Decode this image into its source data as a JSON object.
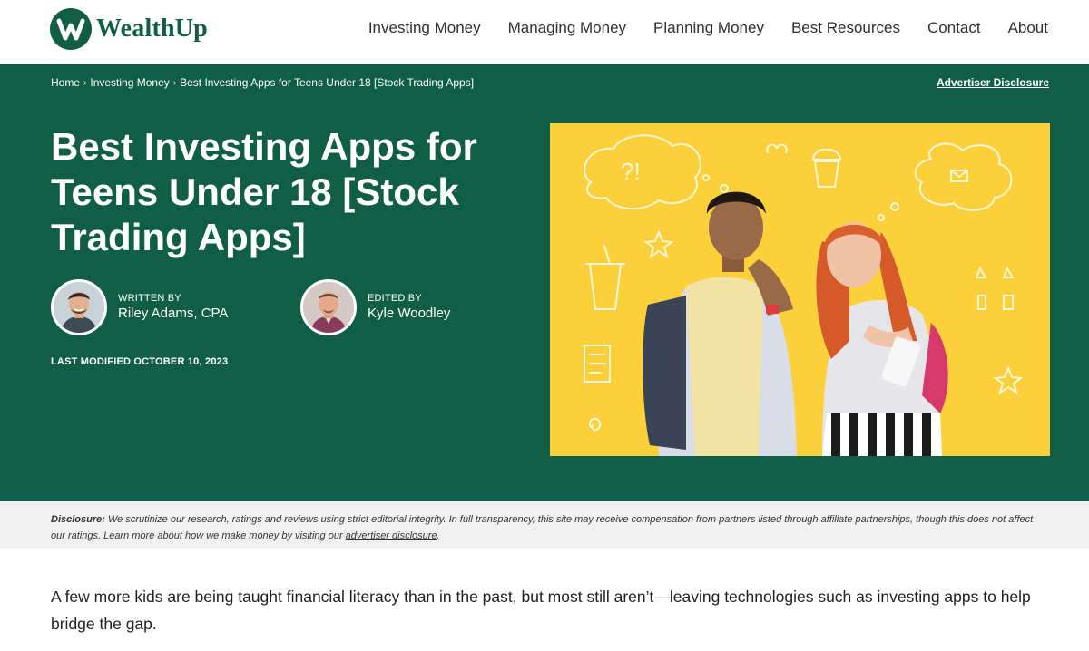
{
  "brand": {
    "name": "WealthUp",
    "color": "#0f5e45"
  },
  "nav": {
    "items": [
      {
        "label": "Investing Money"
      },
      {
        "label": "Managing Money"
      },
      {
        "label": "Planning Money"
      },
      {
        "label": "Best Resources"
      },
      {
        "label": "Contact"
      },
      {
        "label": "About"
      }
    ]
  },
  "breadcrumb": {
    "items": [
      {
        "label": "Home"
      },
      {
        "label": "Investing Money"
      },
      {
        "label": "Best Investing Apps for Teens Under 18 [Stock Trading Apps]"
      }
    ],
    "separator": "›"
  },
  "advertiser_link": "Advertiser Disclosure",
  "article": {
    "title": "Best Investing Apps for Teens Under 18 [Stock Trading Apps]",
    "author": {
      "role": "WRITTEN BY",
      "name": "Riley Adams, CPA"
    },
    "editor": {
      "role": "EDITED BY",
      "name": "Kyle Woodley"
    },
    "last_modified": "LAST MODIFIED OCTOBER 10, 2023",
    "hero_image": {
      "icon": "teens-with-phone-illustration",
      "background": "#fcd03a"
    }
  },
  "disclosure": {
    "label": "Disclosure:",
    "text": "We scrutinize our research, ratings and reviews using strict editorial integrity. In full transparency, this site may receive compensation from partners listed through affiliate partnerships, though this does not affect our ratings. Learn more about how we make money by visiting our",
    "link": "advertiser disclosure",
    "end": "."
  },
  "intro": "A few more kids are being taught financial literacy than in the past, but most still aren’t—leaving technologies such as investing apps to help bridge the gap."
}
